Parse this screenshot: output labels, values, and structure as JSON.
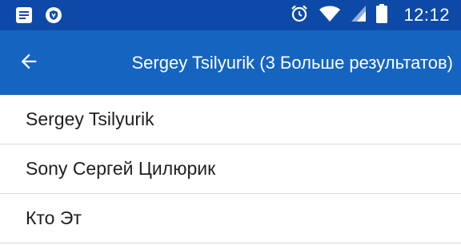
{
  "status_bar": {
    "time": "12:12",
    "icons": [
      "notification-message-icon",
      "shield-icon",
      "alarm-clock-icon",
      "wifi-icon",
      "cell-signal-icon",
      "battery-icon"
    ]
  },
  "app_bar": {
    "title": "Sergey Tsilyurik (3 Больше результатов)",
    "back_icon": "arrow-back-icon"
  },
  "results": [
    {
      "label": "Sergey Tsilyurik"
    },
    {
      "label": "Sony Сергей Цилюрик"
    },
    {
      "label": "Кто Эт"
    }
  ],
  "colors": {
    "status_bar": "#0d4aa8",
    "app_bar": "#1565c0",
    "text": "#1f1f1f",
    "divider": "#d9d9d9"
  }
}
